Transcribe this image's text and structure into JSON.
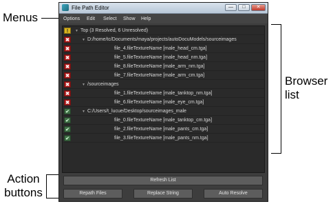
{
  "annotations": {
    "menus": "Menus",
    "browser_line1": "Browser",
    "browser_line2": "list",
    "action_line1": "Action",
    "action_line2": "buttons"
  },
  "window": {
    "title": "File Path Editor",
    "controls": [
      "minimize-icon",
      "maximize-icon",
      "close-icon"
    ]
  },
  "menus": [
    "Options",
    "Edit",
    "Select",
    "Show",
    "Help"
  ],
  "list": {
    "rows": [
      {
        "status": "warning",
        "level": 0,
        "expander": true,
        "text": "Top (3 Resolved, 6 Unresolved)"
      },
      {
        "status": "error",
        "level": 1,
        "expander": true,
        "text": "D:/home/tc/Documents/maya/projects/autoDocuModels/sourceimages"
      },
      {
        "status": "error",
        "level": 2,
        "expander": false,
        "text": "file_4.fileTextureName [male_head_cm.tga]"
      },
      {
        "status": "error",
        "level": 2,
        "expander": false,
        "text": "file_5.fileTextureName [male_head_nm.tga]"
      },
      {
        "status": "error",
        "level": 2,
        "expander": false,
        "text": "file_8.fileTextureName [male_arm_nm.tga]"
      },
      {
        "status": "error",
        "level": 2,
        "expander": false,
        "text": "file_7.fileTextureName [male_arm_cm.tga]"
      },
      {
        "status": "error",
        "level": 1,
        "expander": true,
        "text": "/sourceimages"
      },
      {
        "status": "error",
        "level": 2,
        "expander": false,
        "text": "file_1.fileTextureName [male_tanktop_nm.tga]"
      },
      {
        "status": "error",
        "level": 2,
        "expander": false,
        "text": "file_6.fileTextureName [male_eye_cm.tga]"
      },
      {
        "status": "ok",
        "level": 1,
        "expander": true,
        "text": "C:/Users/t_lucue/Desktop/sourceimages_male"
      },
      {
        "status": "ok",
        "level": 2,
        "expander": false,
        "text": "file_0.fileTextureName [male_tanktop_cm.tga]"
      },
      {
        "status": "ok",
        "level": 2,
        "expander": false,
        "text": "file_2.fileTextureName [male_pants_cm.tga]"
      },
      {
        "status": "ok",
        "level": 2,
        "expander": false,
        "text": "file_3.fileTextureName [male_pants_nm.tga]"
      }
    ]
  },
  "buttons": {
    "refresh": "Refresh List",
    "repath": "Repath Files",
    "replace": "Replace String",
    "auto_resolve": "Auto Resolve"
  },
  "colors": {
    "panel_bg": "#3d3d3d",
    "list_bg": "#2a2a2a",
    "error": "#b01f1f",
    "ok": "#3f6e45",
    "warning": "#d8b41f"
  }
}
